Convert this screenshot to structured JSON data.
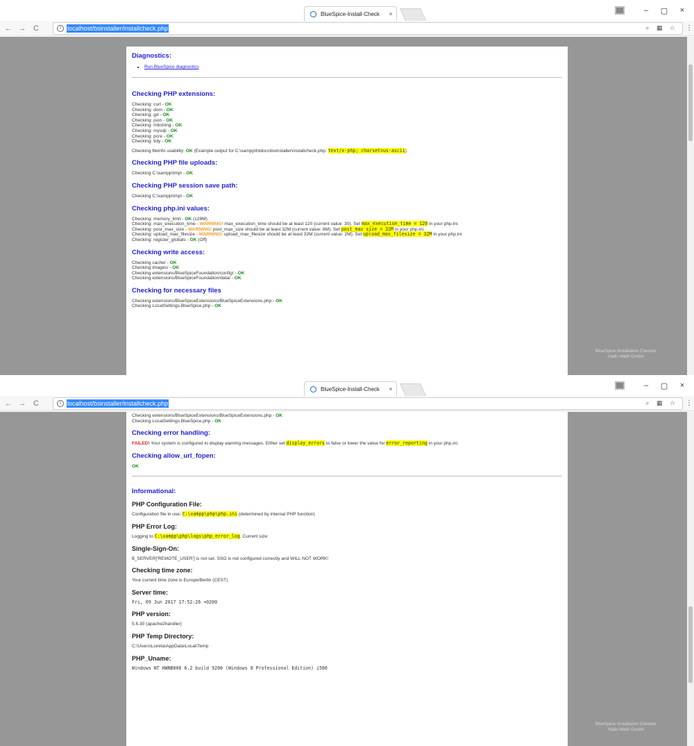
{
  "browser": {
    "tab_title": "BlueSpice-Install-Check",
    "tab_close": "×",
    "url": "localhost/bsinstaller/installcheck.php",
    "info_glyph": "i",
    "nav_back": "←",
    "nav_forward": "→",
    "nav_reload": "C",
    "win_min": "–",
    "win_max": "▢",
    "win_close": "×",
    "omni_icons": "⌕ ▦ ☆",
    "menu_glyph": "⋮"
  },
  "footer": {
    "line1": "BlueSpice Installation Checker",
    "line2": "Hallo Welt! GmbH"
  },
  "screen1": {
    "diagnostics_heading": "Diagnostics:",
    "diagnostics_link": "Run BlueSpice diagnostics",
    "ext_heading": "Checking PHP extensions:",
    "ext_prefix": "Checking: ",
    "ext_sep": " - ",
    "ok": "OK",
    "extensions": [
      "curl",
      "dom",
      "gd",
      "json",
      "mbstring",
      "mysqli",
      "pcre",
      "tidy"
    ],
    "fileinfo_pre": "Checking fileinfo usability: ",
    "fileinfo_mid": " (Example output for C:\\xampp\\htdocs\\bsInstaller\\installcheck.php: ",
    "fileinfo_hl": "text/x-php; charset=us-ascii",
    "fileinfo_post": ")",
    "uploads_heading": "Checking PHP file uploads:",
    "uploads_line": "Checking C:\\xampp\\tmp\\ - ",
    "session_heading": "Checking PHP session save path:",
    "session_line": "Checking C:\\xampp\\tmp\\ - ",
    "ini_heading": "Checking php.ini values:",
    "ini_mem_pre": "Checking: memory_limit - ",
    "ini_mem_post": " (128M)",
    "warning": "WARNING!",
    "ini_met_pre": "Checking: max_execution_time - ",
    "ini_met_mid": " max_execution_time should be at least 120 (current value: 30). Set ",
    "ini_met_hl": "max_execution_time = 120",
    "ini_met_post": " in your php.ini.",
    "ini_pms_pre": "Checking: post_max_size - ",
    "ini_pms_mid": " post_max_size should be at least 32M (current value: 8M). Set ",
    "ini_pms_hl": "post_max_size = 32M",
    "ini_pms_post": " in your php.ini.",
    "ini_umf_pre": "Checking: upload_max_filesize - ",
    "ini_umf_mid": " upload_max_filesize should be at least 32M (current value: 2M). Set ",
    "ini_umf_hl": "upload_max_filesize = 32M",
    "ini_umf_post": " in your php.ini.",
    "ini_rg_pre": "Checking: register_globals - ",
    "ini_rg_post": " (Off)",
    "write_heading": "Checking write access:",
    "write_items": [
      "cache/",
      "images/",
      "extensions/BlueSpiceFoundation/config/",
      "extensions/BlueSpiceFoundation/data/"
    ],
    "write_prefix": "Checking ",
    "files_heading": "Checking for necessary files",
    "files_items": [
      "extensions/BlueSpiceExtensions/BlueSpiceExtensions.php",
      "LocalSettings.BlueSpice.php"
    ]
  },
  "screen2": {
    "files_items": [
      "extensions/BlueSpiceExtensions/BlueSpiceExtensions.php",
      "LocalSettings.BlueSpice.php"
    ],
    "files_prefix": "Checking ",
    "ok": "OK",
    "err_heading": "Checking error handling:",
    "failed": "FAILED!",
    "err_mid": " Your system is configured to display warning messages. Either set ",
    "err_hl1": "display_errors",
    "err_mid2": " to false or lower the value for ",
    "err_hl2": "error_reporting",
    "err_post": " in your php.ini.",
    "url_heading": "Checking allow_url_fopen:",
    "info_heading": "Informational:",
    "config_heading": "PHP Configuration File:",
    "config_pre": "Configuration file in use: ",
    "config_hl": "C:\\xampp\\php\\php.ini",
    "config_post": " (determined by internal PHP function)",
    "errlog_heading": "PHP Error Log:",
    "errlog_pre": "Logging to ",
    "errlog_hl": "C:\\xampp\\php\\logs\\php_error_log",
    "errlog_post": ". Current size:",
    "sso_heading": "Single-Sign-On:",
    "sso_line": "$_SERVER['REMOTE_USER'] is not set. SSO is not configured correctly and WILL NOT WORK!",
    "tz_heading": "Checking time zone:",
    "tz_line": "Your current time zone is Europe/Berlin (CEST)",
    "time_heading": "Server time:",
    "time_line": "Fri, 09 Jun 2017 17:52:26 +0200",
    "ver_heading": "PHP version:",
    "ver_line": "5.6.30 (apache2handler)",
    "temp_heading": "PHP Temp Directory:",
    "temp_line": "C:\\Users\\Lsireta\\AppData\\Local\\Temp",
    "uname_heading": "PHP_Uname:",
    "uname_line": "Windows NT HWNB006 6.2 build 9200 (Windows 8 Professional Edition) i586"
  }
}
